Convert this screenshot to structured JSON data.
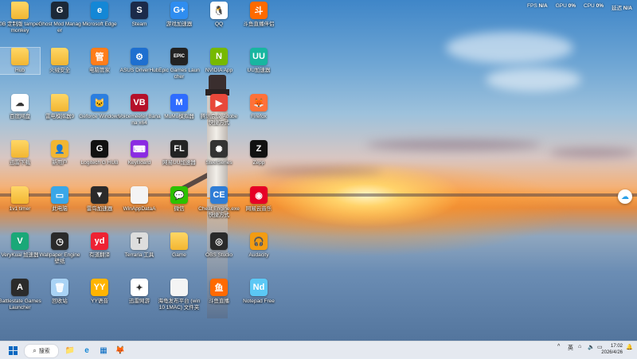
{
  "hw_monitor": {
    "fps_label": "FPS",
    "fps_value": "N/A",
    "gpu_label": "GPU",
    "gpu_value": "0%",
    "cpu_label": "CPU",
    "cpu_value": "0%",
    "delay_label": "延迟",
    "delay_value": "N/A"
  },
  "desktop_icons": [
    {
      "label": "0B 定制版 tampermonkey",
      "icon": "folder-icon",
      "type": "folder"
    },
    {
      "label": "Ghost Mod Manager",
      "icon": "ghost-icon",
      "color": "#1b2838",
      "glyph": "G"
    },
    {
      "label": "Microsoft Edge",
      "icon": "edge-icon",
      "color": "#1487d6",
      "glyph": "e"
    },
    {
      "label": "Steam",
      "icon": "steam-icon",
      "color": "#1b2a4a",
      "glyph": "S"
    },
    {
      "label": "游戏加速器",
      "icon": "accelerator-icon",
      "color": "#2f8df0",
      "glyph": "G+"
    },
    {
      "label": "QQ",
      "icon": "qq-icon",
      "color": "#ffffff",
      "glyph": "🐧"
    },
    {
      "label": "斗鱼直播伴侣",
      "icon": "douyu-icon",
      "color": "#ff6a00",
      "glyph": "斗"
    },
    {
      "label": "Hub",
      "icon": "folder-icon",
      "type": "folder",
      "selected": true
    },
    {
      "label": "火绒安全",
      "icon": "folder-icon",
      "type": "folder"
    },
    {
      "label": "电脑管家",
      "icon": "pc-manager-icon",
      "color": "#ff7d1a",
      "glyph": "管"
    },
    {
      "label": "ASUS DriverHub",
      "icon": "gear-icon",
      "color": "#1e6fd0",
      "glyph": "⚙"
    },
    {
      "label": "Epic Games Launcher",
      "icon": "epic-icon",
      "color": "#222222",
      "glyph": "EPIC"
    },
    {
      "label": "NVIDIA App",
      "icon": "nvidia-icon",
      "color": "#76b900",
      "glyph": "N"
    },
    {
      "label": "UU加速器",
      "icon": "uu-icon",
      "color": "#18b6a0",
      "glyph": "UU"
    },
    {
      "label": "百度网盘",
      "icon": "baidu-cloud-icon",
      "color": "#ffffff",
      "glyph": "☁"
    },
    {
      "label": "雷电模拟器9",
      "icon": "folder-icon",
      "type": "folder"
    },
    {
      "label": "Geforce Windows",
      "icon": "cat-icon",
      "color": "#2b7ee0",
      "glyph": "🐱"
    },
    {
      "label": "Voicemeeter Banana x64",
      "icon": "voicemeeter-icon",
      "color": "#b5102a",
      "glyph": "VB"
    },
    {
      "label": "MuMu模拟器",
      "icon": "mumu-icon",
      "color": "#2e6cff",
      "glyph": "M"
    },
    {
      "label": "腾讯会议 Adobe 快捷方式",
      "icon": "meeting-icon",
      "color": "#e8483a",
      "glyph": "▶"
    },
    {
      "label": "Firefox",
      "icon": "firefox-icon",
      "color": "#ff7139",
      "glyph": "🦊"
    },
    {
      "label": "迅雷下载",
      "icon": "folder-icon",
      "type": "folder"
    },
    {
      "label": "新用户",
      "icon": "user-folder-icon",
      "color": "#f2b632",
      "glyph": "👤"
    },
    {
      "label": "Logitech G HUB",
      "icon": "logitech-icon",
      "color": "#111111",
      "glyph": "G"
    },
    {
      "label": "KeyBoard",
      "icon": "keyboard-icon",
      "color": "#8a2be2",
      "glyph": "⌨"
    },
    {
      "label": "网易UU加速器",
      "icon": "netease-icon",
      "color": "#232323",
      "glyph": "FL"
    },
    {
      "label": "SteelSeries",
      "icon": "steelseries-icon",
      "color": "#333333",
      "glyph": "✺"
    },
    {
      "label": "Zepp",
      "icon": "zepp-icon",
      "color": "#111111",
      "glyph": "Z"
    },
    {
      "label": "1v1 timer",
      "icon": "folder-icon",
      "type": "folder"
    },
    {
      "label": "此电脑",
      "icon": "monitor-icon",
      "color": "#39a7e8",
      "glyph": "▭"
    },
    {
      "label": "雷鸟加速器",
      "icon": "thunder-icon",
      "color": "#2a2a2a",
      "glyph": "▼"
    },
    {
      "label": "WinAppDataA",
      "icon": "file-icon",
      "color": "#f4f4f4",
      "glyph": ""
    },
    {
      "label": "微信",
      "icon": "wechat-icon",
      "color": "#2dc100",
      "glyph": "💬"
    },
    {
      "label": "Cheat Engine.exe 快捷方式",
      "icon": "cheat-engine-icon",
      "color": "#2f7dd6",
      "glyph": "CE"
    },
    {
      "label": "网易云音乐",
      "icon": "netease-music-icon",
      "color": "#e60026",
      "glyph": "◉"
    },
    {
      "label": "VeryKuai 加速器",
      "icon": "verykuai-icon",
      "color": "#1aa878",
      "glyph": "V"
    },
    {
      "label": "Wallpaper Engine 壁纸",
      "icon": "wallpaper-icon",
      "color": "#2a2a2a",
      "glyph": "◷"
    },
    {
      "label": "有道翻译",
      "icon": "youdao-icon",
      "color": "#e23",
      "glyph": "yd"
    },
    {
      "label": "Terraria 工具",
      "icon": "terraria-icon",
      "color": "#dddddd",
      "glyph": "T"
    },
    {
      "label": "Game",
      "icon": "folder-icon",
      "type": "folder"
    },
    {
      "label": "OBS Studio",
      "icon": "obs-icon",
      "color": "#2a2a2a",
      "glyph": "◎"
    },
    {
      "label": "Audacity",
      "icon": "audacity-icon",
      "color": "#f39c12",
      "glyph": "🎧"
    },
    {
      "label": "Battlestate Games Launcher",
      "icon": "battlestate-icon",
      "color": "#2b2b2b",
      "glyph": "A"
    },
    {
      "label": "回收站",
      "icon": "recycle-bin-icon",
      "color": "#a9d3f5",
      "glyph": "🗑"
    },
    {
      "label": "YY语音",
      "icon": "yy-icon",
      "color": "#ffb400",
      "glyph": "YY"
    },
    {
      "label": "迅雷网游",
      "icon": "xunlei-icon",
      "color": "#ffffff",
      "glyph": "✦"
    },
    {
      "label": "海龟发布平台 (win10 1MAC) 文件夹",
      "icon": "file-icon",
      "color": "#f4f4f4",
      "glyph": ""
    },
    {
      "label": "斗鱼直播",
      "icon": "douyu-live-icon",
      "color": "#ff6a00",
      "glyph": "鱼"
    },
    {
      "label": "Notepad Free",
      "icon": "notepad-icon",
      "color": "#5bc8f5",
      "glyph": "Nd"
    }
  ],
  "floating_widget": {
    "icon": "cloud-icon"
  },
  "taskbar": {
    "search_label": "搜索",
    "pinned": [
      {
        "icon": "file-explorer-icon",
        "glyph": "📁"
      },
      {
        "icon": "edge-icon",
        "glyph": "e"
      },
      {
        "icon": "store-icon",
        "glyph": "▦"
      },
      {
        "icon": "firefox-icon",
        "glyph": "🦊"
      }
    ],
    "tray_chevron": "^",
    "ime": "英",
    "time": "17:02",
    "date": "2026/4/26"
  },
  "colors": {
    "taskbar_bg": "#ebeef4",
    "folder": "#f2b632",
    "win_blue": "#0067c0"
  }
}
